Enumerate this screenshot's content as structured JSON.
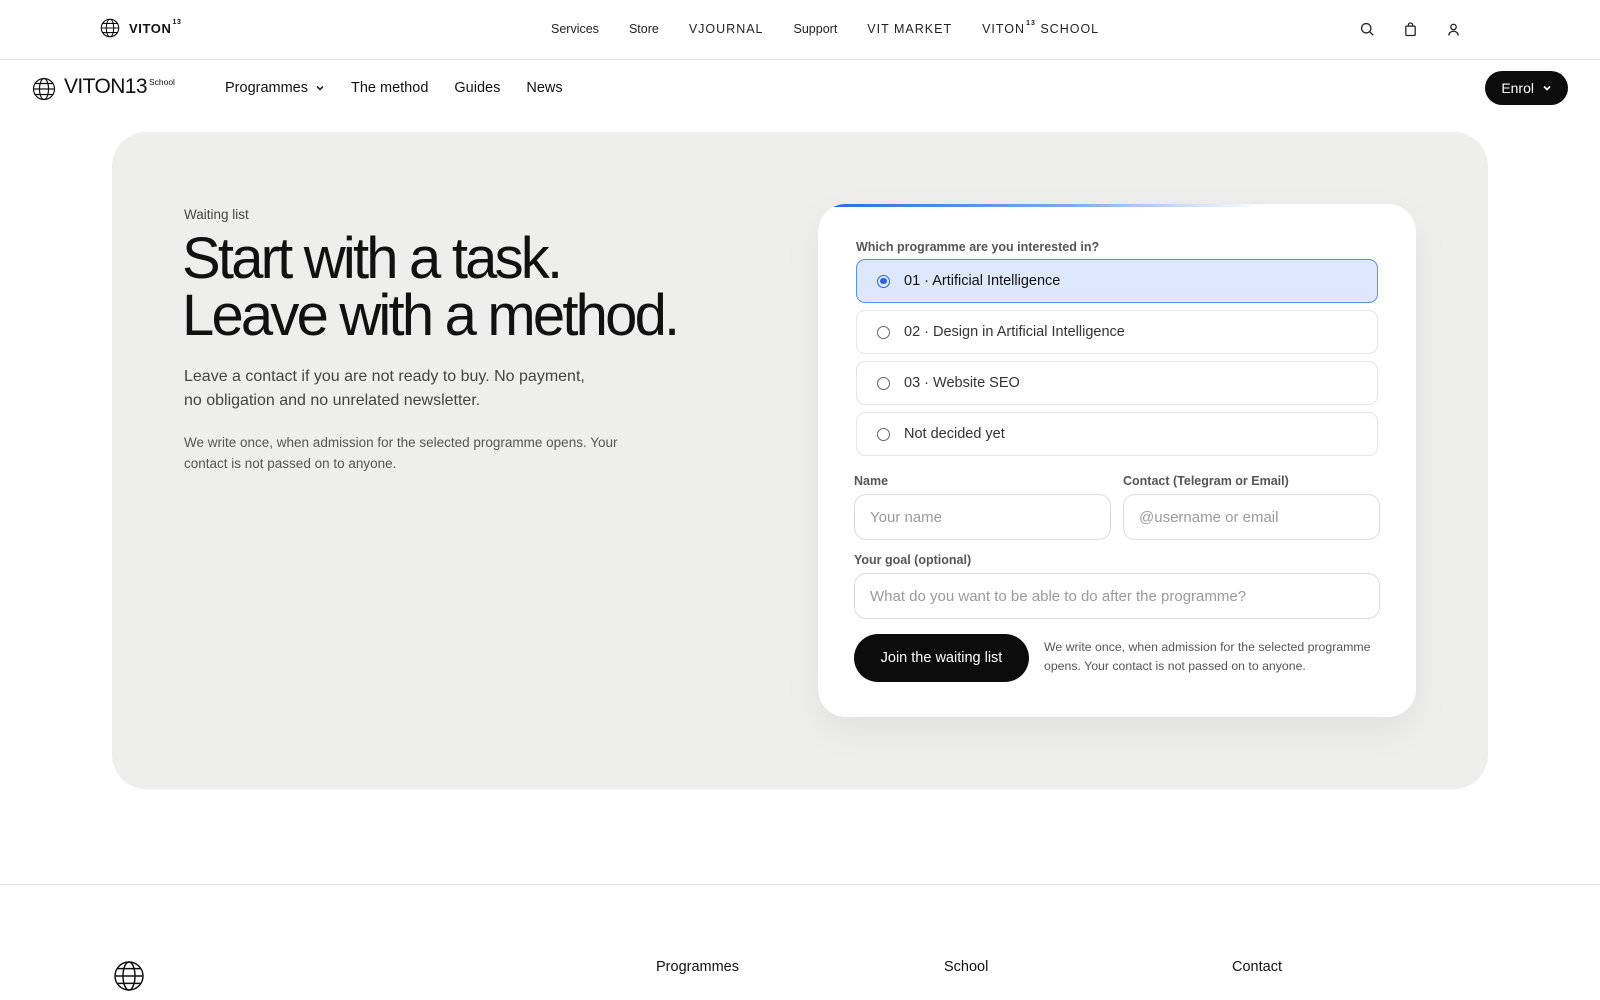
{
  "topbar": {
    "brand": "VITON",
    "brand_sup": "13",
    "nav": [
      "Services",
      "Store",
      "VJOURNAL",
      "Support",
      "VIT MARKET"
    ],
    "school_link_pre": "VITON",
    "school_link_sup": "13",
    "school_link_post": "SCHOOL",
    "icons": [
      "search-icon",
      "bag-icon",
      "user-icon"
    ]
  },
  "schoolnav": {
    "brand": "VITON13",
    "brand_suffix": "School",
    "programmes": "Programmes",
    "method": "The method",
    "guides": "Guides",
    "news": "News",
    "enrol": "Enrol"
  },
  "hero": {
    "eyebrow": "Waiting list",
    "headline_line1": "Start with a task.",
    "headline_line2": "Leave with a method.",
    "lead": "Leave a contact if you are not ready to buy. No payment, no obligation and no unrelated newsletter.",
    "note": "We write once, when admission for the selected programme opens. Your contact is not passed on to anyone."
  },
  "form": {
    "question": "Which programme are you interested in?",
    "options": [
      {
        "label": "01 · Artificial Intelligence",
        "selected": true
      },
      {
        "label": "02 · Design in Artificial Intelligence",
        "selected": false
      },
      {
        "label": "03 · Website SEO",
        "selected": false
      },
      {
        "label": "Not decided yet",
        "selected": false
      }
    ],
    "name_label": "Name",
    "name_placeholder": "Your name",
    "name_value": "",
    "contact_label": "Contact (Telegram or Email)",
    "contact_placeholder": "@username or email",
    "contact_value": "",
    "goal_label": "Your goal (optional)",
    "goal_placeholder": "What do you want to be able to do after the programme?",
    "goal_value": "",
    "submit": "Join the waiting list",
    "note": "We write once, when admission for the selected programme opens. Your contact is not passed on to anyone.",
    "accent_color": "#2d6cdf",
    "selected_bg": "#dde8fd"
  },
  "footer": {
    "col1": "Programmes",
    "col2": "School",
    "col3": "Contact"
  }
}
